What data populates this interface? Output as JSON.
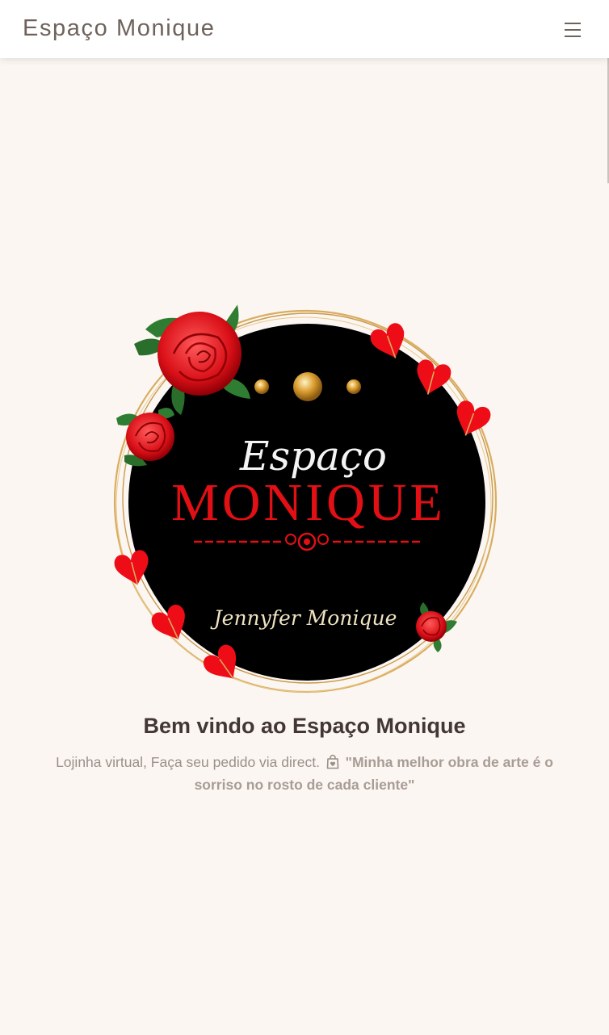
{
  "nav": {
    "brand": "Espaço Monique",
    "menu_icon": "hamburger-menu-icon"
  },
  "logo": {
    "script_word": "Espaço",
    "main_word": "MONIQUE",
    "signature": "Jennyfer Monique",
    "colors": {
      "circle": "#000000",
      "ring": "#d7a85a",
      "title_red": "#e20f15",
      "signature_gold": "#efe3c0",
      "rose": "#e2141c",
      "leaf": "#2f7d32"
    }
  },
  "hero": {
    "title": "Bem vindo ao Espaço Monique",
    "text_lead": "Lojinha virtual, Faça seu pedido via direct.",
    "bag_icon": "shopping-bag-heart-icon",
    "quote": "\"Minha melhor obra de arte é o sorriso no rosto de cada cliente\""
  }
}
